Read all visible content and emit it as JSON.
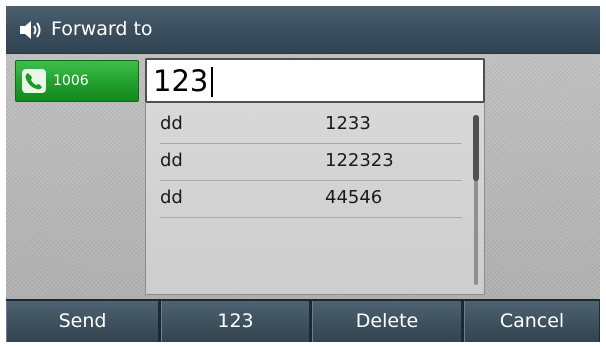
{
  "header": {
    "title": "Forward to",
    "icon": "speaker-icon"
  },
  "line_key": {
    "label": "1006",
    "icon": "phone-handset-icon",
    "color": "#22a22f"
  },
  "input": {
    "value": "123"
  },
  "suggestions": [
    {
      "name": "dd",
      "number": "1233"
    },
    {
      "name": "dd",
      "number": "122323"
    },
    {
      "name": "dd",
      "number": "44546"
    }
  ],
  "softkeys": {
    "send": "Send",
    "num_mode": "123",
    "delete": "Delete",
    "cancel": "Cancel"
  }
}
